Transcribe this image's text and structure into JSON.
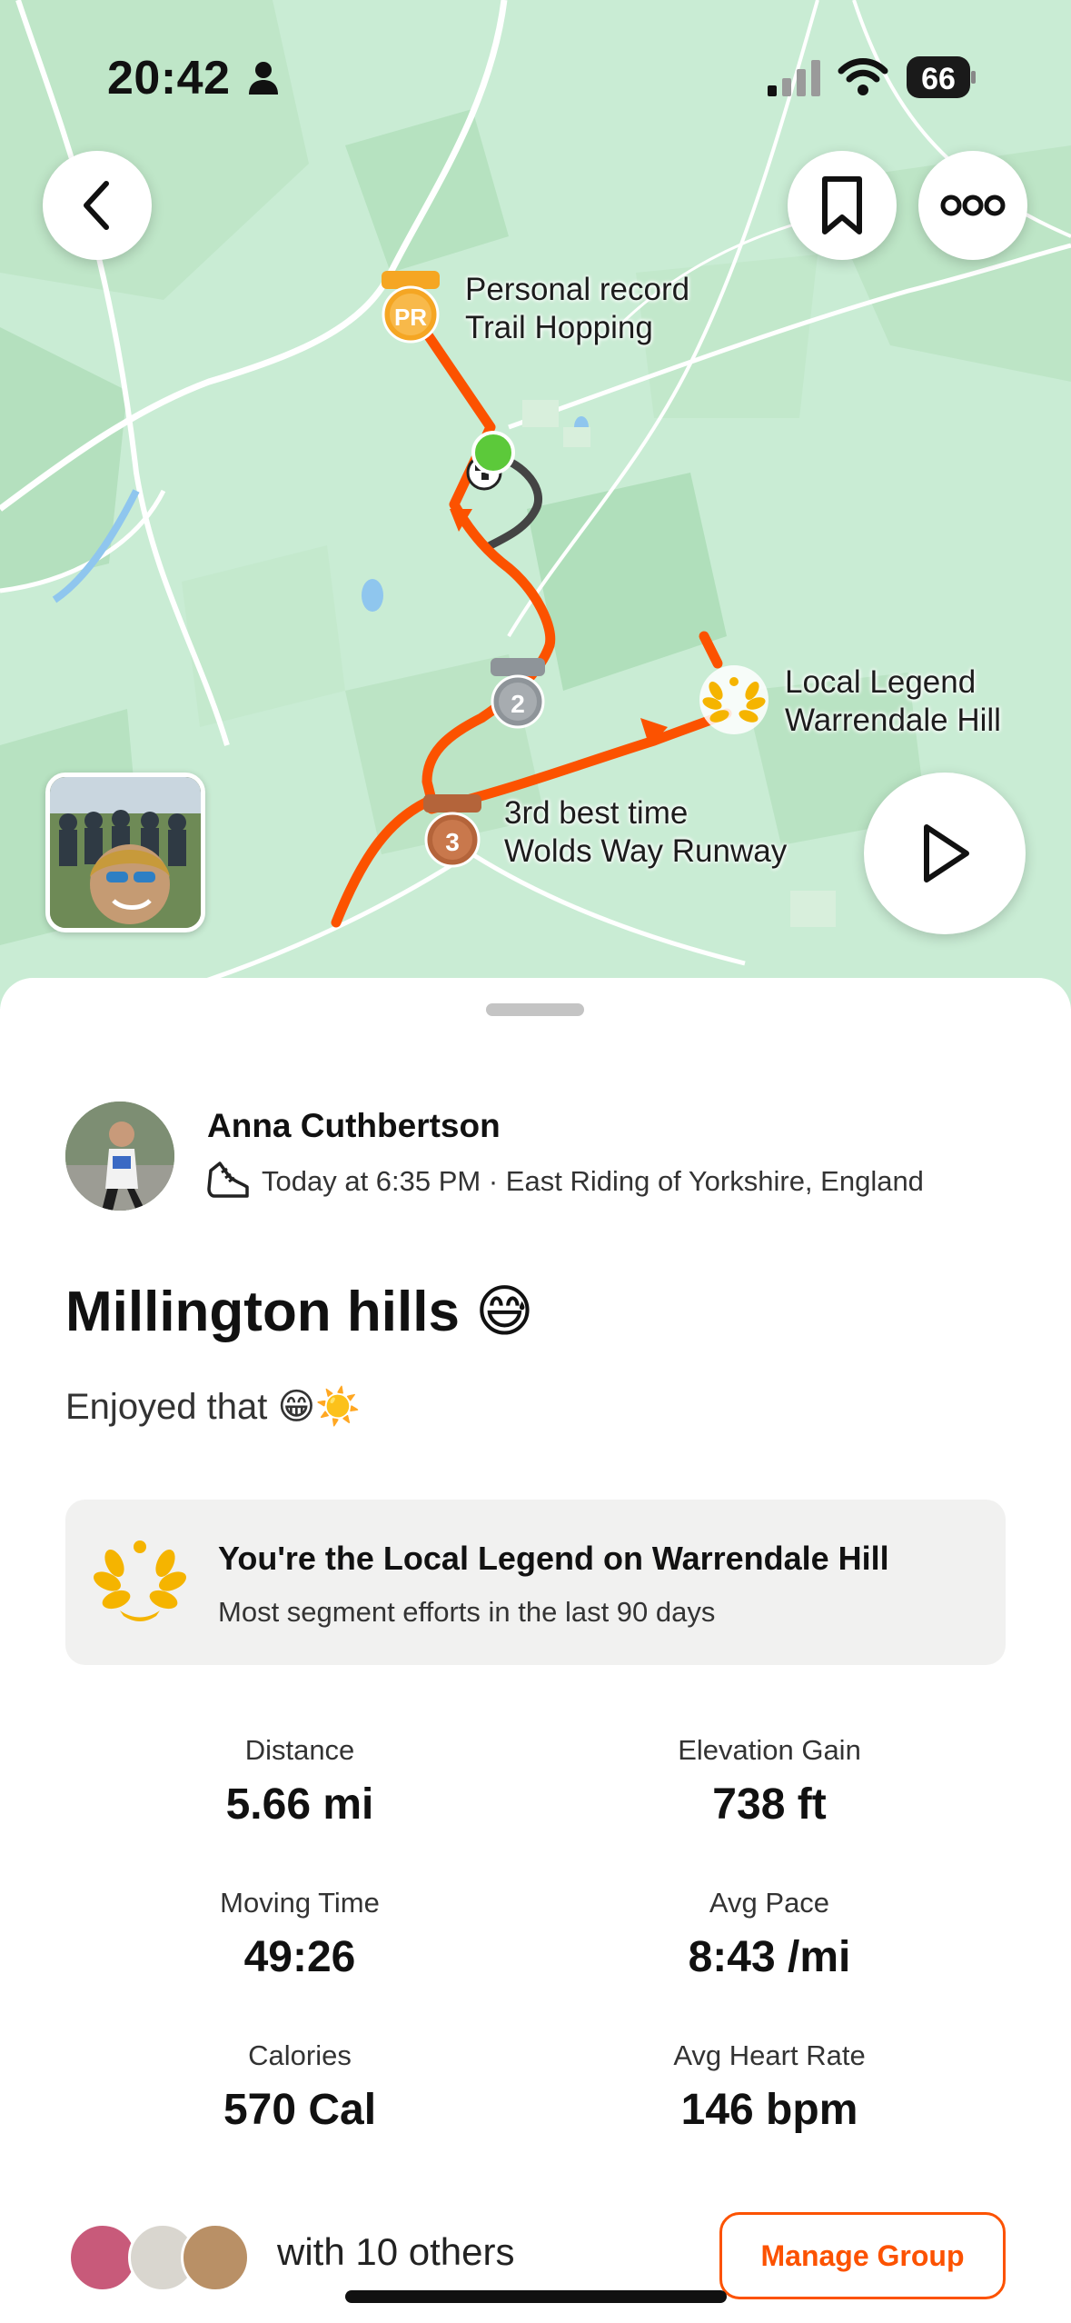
{
  "status_bar": {
    "time": "20:42",
    "battery": "66"
  },
  "map": {
    "labels": {
      "pr_line1": "Personal record",
      "pr_line2": "Trail Hopping",
      "legend_line1": "Local Legend",
      "legend_line2": "Warrendale Hill",
      "third_line1": "3rd best time",
      "third_line2": "Wolds Way Runway"
    },
    "medals": {
      "pr": "PR",
      "second": "2",
      "third": "3"
    },
    "route_color": "#fc5200",
    "map_color": "#c9ecd4"
  },
  "activity": {
    "athlete_name": "Anna Cuthbertson",
    "meta": "Today at 6:35 PM · East Riding of Yorkshire, England",
    "title": "Millington hills 😅",
    "description": "Enjoyed that 😁☀️"
  },
  "legend_card": {
    "title": "You're the Local Legend on Warrendale Hill",
    "subtitle": "Most segment efforts in the last 90 days"
  },
  "stats": [
    {
      "label": "Distance",
      "value": "5.66 mi"
    },
    {
      "label": "Elevation Gain",
      "value": "738 ft"
    },
    {
      "label": "Moving Time",
      "value": "49:26"
    },
    {
      "label": "Avg Pace",
      "value": "8:43 /mi"
    },
    {
      "label": "Calories",
      "value": "570 Cal"
    },
    {
      "label": "Avg Heart Rate",
      "value": "146 bpm"
    }
  ],
  "group": {
    "text": "with 10 others",
    "manage_label": "Manage Group"
  },
  "accent_color": "#fc5200"
}
